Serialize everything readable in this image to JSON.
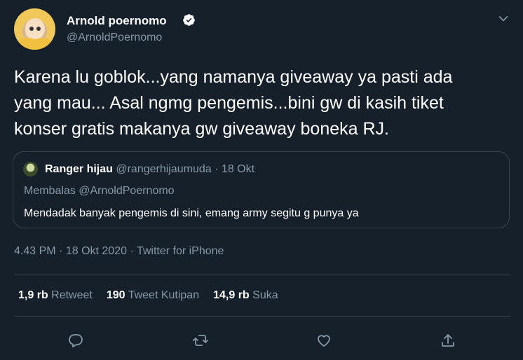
{
  "author": {
    "name": "Arnold poernomo",
    "handle": "@ArnoldPoernomo"
  },
  "tweet": {
    "lines": [
      "Karena lu goblok...yang namanya giveaway ya pasti ada",
      "yang mau... Asal ngmg pengemis...bini gw di kasih tiket",
      "konser gratis makanya gw giveaway boneka RJ."
    ]
  },
  "quote": {
    "name": "Ranger hijau",
    "handle": "@rangerhijaumuda",
    "separator": "·",
    "date": "18 Okt",
    "reply_to": "Membalas @ArnoldPoernomo",
    "text": "Mendadak banyak pengemis di sini, emang army segitu g punya ya"
  },
  "meta": {
    "time": "4.43 PM",
    "date": "18 Okt 2020",
    "source": "Twitter for iPhone",
    "separator": "·"
  },
  "stats": {
    "retweets_count": "1,9 rb",
    "retweets_label": "Retweet",
    "quotes_count": "190",
    "quotes_label": "Tweet Kutipan",
    "likes_count": "14,9 rb",
    "likes_label": "Suka"
  },
  "icons": {
    "verified": "verified-badge-icon",
    "more": "chevron-down-icon",
    "reply": "reply-icon",
    "retweet": "retweet-icon",
    "like": "heart-icon",
    "share": "share-icon"
  },
  "colors": {
    "background": "#15202b",
    "secondary_text": "#8899a6",
    "border": "#38444d"
  }
}
